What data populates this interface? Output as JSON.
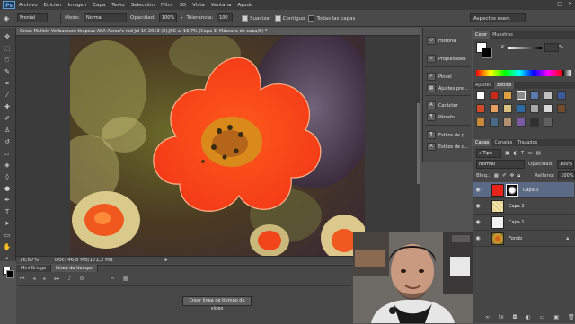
{
  "app": {
    "logo": "Ps"
  },
  "menu": [
    "Archivo",
    "Edición",
    "Imagen",
    "Capa",
    "Texto",
    "Selección",
    "Filtro",
    "3D",
    "Vista",
    "Ventana",
    "Ayuda"
  ],
  "options_bar": {
    "preset": "Frontal",
    "mode_label": "Modo:",
    "mode_value": "Normal",
    "opacity_label": "Opacidad:",
    "opacity_value": "100%",
    "tolerance_label": "Tolerancia:",
    "tolerance_value": "100",
    "antialias_label": "Suavizar",
    "contiguous_label": "Contiguo",
    "all_layers_label": "Todas las capas"
  },
  "workspace": "Aspectos esen.",
  "document": {
    "title": "Great Mullein Verbascum thapsus AKA Aaron's rod Jul 19 2013 (2).JPG al 16,7% (Capa 3, Máscara de capa/8) *",
    "zoom": "16,67%",
    "doc_info": "Doc: 46,8 MB/171,2 MB"
  },
  "timeline": {
    "tabs": [
      "Mini Bridge",
      "Línea de tiempo"
    ],
    "create_button": "Crear línea de tiempo de vídeo"
  },
  "dock": {
    "items": [
      "Historia",
      "Propiedades",
      "Pincel",
      "Ajustes pre...",
      "Carácter",
      "Párrafo",
      "Estilos de p...",
      "Estilos de c..."
    ]
  },
  "color_panel": {
    "tabs": [
      "Color",
      "Muestras"
    ],
    "channel_label": "K",
    "channel_value": "%"
  },
  "adjust_panel": {
    "tabs": [
      "Ajustes",
      "Estilos"
    ]
  },
  "layers_panel": {
    "tabs": [
      "Capas",
      "Canales",
      "Trazados"
    ],
    "kind_label": "Tipo",
    "blend_mode": "Normal",
    "opacity_label": "Opacidad:",
    "opacity_value": "100%",
    "lock_label": "Bloq.:",
    "fill_label": "Relleno:",
    "fill_value": "100%",
    "layers": [
      {
        "name": "Capa 3",
        "thumb_color": "#e8231a",
        "has_mask": true
      },
      {
        "name": "Capa 2",
        "thumb_color": "#f2e6b0",
        "has_mask": false
      },
      {
        "name": "Capa 1",
        "thumb_color": "#f1f1f1",
        "has_mask": false
      },
      {
        "name": "Fondo",
        "thumb_color": "#c8a030",
        "has_mask": false
      }
    ]
  },
  "colors": {
    "accent_red": "#e8231a",
    "panel_bg": "#464646",
    "selected_layer": "#5c6b85"
  }
}
